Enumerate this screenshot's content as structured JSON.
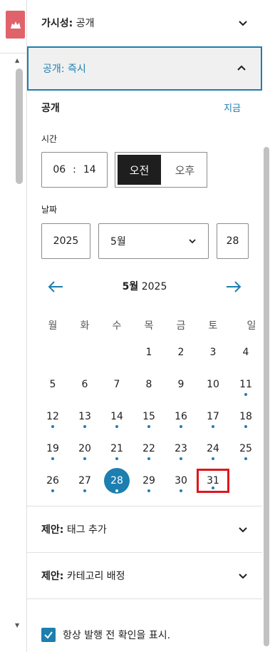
{
  "visibility": {
    "label": "가시성",
    "value": "공개"
  },
  "publish": {
    "label": "공개",
    "value": "즉시"
  },
  "schedule": {
    "title": "공개",
    "now_link": "지금",
    "time_label": "시간",
    "hour": "06",
    "separator": ":",
    "minute": "14",
    "am": "오전",
    "pm": "오후",
    "date_label": "날짜",
    "year": "2025",
    "month": "5월",
    "day": "28"
  },
  "calendar": {
    "month_bold": "5월",
    "year": "2025",
    "weekdays": [
      "월",
      "화",
      "수",
      "목",
      "금",
      "토",
      "일"
    ],
    "days": [
      {
        "n": "1",
        "dot": false
      },
      {
        "n": "2",
        "dot": false
      },
      {
        "n": "3",
        "dot": false
      },
      {
        "n": "4",
        "dot": false
      },
      {
        "n": "5",
        "dot": false
      },
      {
        "n": "6",
        "dot": false
      },
      {
        "n": "7",
        "dot": false
      },
      {
        "n": "8",
        "dot": false
      },
      {
        "n": "9",
        "dot": false
      },
      {
        "n": "10",
        "dot": false
      },
      {
        "n": "11",
        "dot": true
      },
      {
        "n": "12",
        "dot": true
      },
      {
        "n": "13",
        "dot": true
      },
      {
        "n": "14",
        "dot": true
      },
      {
        "n": "15",
        "dot": true
      },
      {
        "n": "16",
        "dot": true
      },
      {
        "n": "17",
        "dot": true
      },
      {
        "n": "18",
        "dot": true
      },
      {
        "n": "19",
        "dot": true
      },
      {
        "n": "20",
        "dot": true
      },
      {
        "n": "21",
        "dot": true
      },
      {
        "n": "22",
        "dot": true
      },
      {
        "n": "23",
        "dot": true
      },
      {
        "n": "24",
        "dot": true
      },
      {
        "n": "25",
        "dot": true
      },
      {
        "n": "26",
        "dot": true
      },
      {
        "n": "27",
        "dot": true
      },
      {
        "n": "28",
        "dot": true,
        "selected": true
      },
      {
        "n": "29",
        "dot": true
      },
      {
        "n": "30",
        "dot": true
      },
      {
        "n": "31",
        "dot": true,
        "highlight": true
      }
    ]
  },
  "suggest_tags": {
    "label": "제안",
    "value": "태그 추가"
  },
  "suggest_category": {
    "label": "제안",
    "value": "카테고리 배정"
  },
  "always_confirm": {
    "label": "항상 발행 전 확인을 표시.",
    "checked": true
  },
  "colors": {
    "accent": "#1d7eb0",
    "highlight": "#e0161b",
    "logo": "#e0626b"
  }
}
